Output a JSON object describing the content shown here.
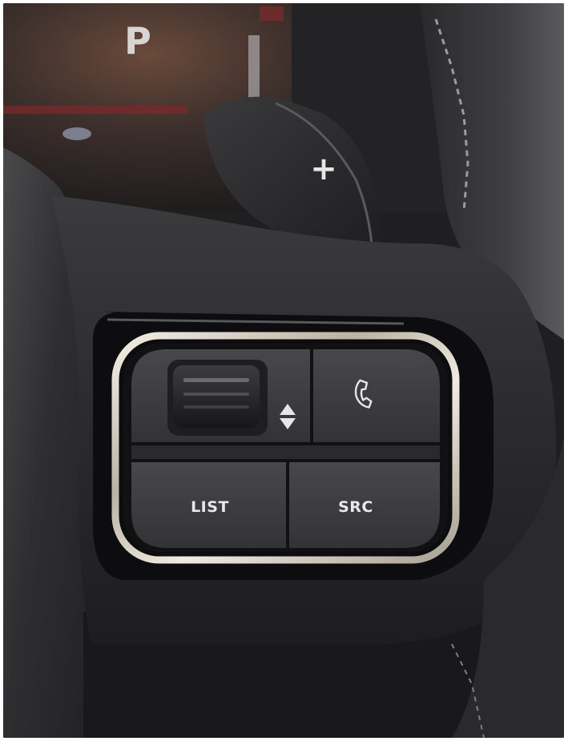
{
  "instrument_cluster": {
    "gear_indicator": "P"
  },
  "paddle_shifter": {
    "label": "+"
  },
  "steering_wheel_controls": {
    "list_button": "LIST",
    "src_button": "SRC",
    "phone_button_icon": "phone-icon",
    "scroll_wheel_icon": "up-down-arrows-icon",
    "trim_color": "#d8d2c8",
    "button_color": "#3a3a3d"
  }
}
